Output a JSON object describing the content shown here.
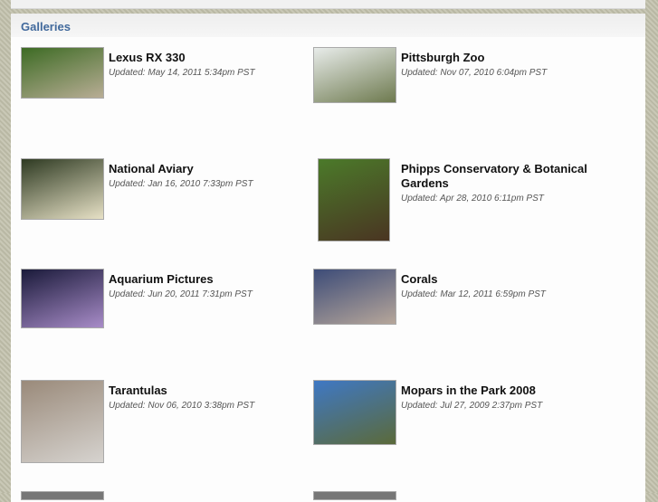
{
  "section_title": "Galleries",
  "galleries": [
    {
      "title": "Lexus RX 330",
      "updated": "Updated: May 14, 2011 5:34pm PST",
      "thumb_colors": [
        "#3d6b24",
        "#b8ad95"
      ]
    },
    {
      "title": "Pittsburgh Zoo",
      "updated": "Updated: Nov 07, 2010 6:04pm PST",
      "thumb_colors": [
        "#e8ecea",
        "#6e7a4f"
      ]
    },
    {
      "title": "National Aviary",
      "updated": "Updated: Jan 16, 2010 7:33pm PST",
      "thumb_colors": [
        "#2e3a22",
        "#e7e1c6"
      ]
    },
    {
      "title": "Phipps Conservatory & Botanical Gardens",
      "updated": "Updated: Apr 28, 2010 6:11pm PST",
      "thumb_colors": [
        "#4b7a2a",
        "#4a3522"
      ]
    },
    {
      "title": "Aquarium Pictures",
      "updated": "Updated: Jun 20, 2011 7:31pm PST",
      "thumb_colors": [
        "#1a1a3a",
        "#a88cc8"
      ]
    },
    {
      "title": "Corals",
      "updated": "Updated: Mar 12, 2011 6:59pm PST",
      "thumb_colors": [
        "#3d4c78",
        "#b6a69a"
      ]
    },
    {
      "title": "Tarantulas",
      "updated": "Updated: Nov 06, 2010 3:38pm PST",
      "thumb_colors": [
        "#9a8a7a",
        "#d6d3cf"
      ]
    },
    {
      "title": "Mopars in the Park 2008",
      "updated": "Updated: Jul 27, 2009 2:37pm PST",
      "thumb_colors": [
        "#3f78c4",
        "#5b6a3a"
      ]
    }
  ]
}
